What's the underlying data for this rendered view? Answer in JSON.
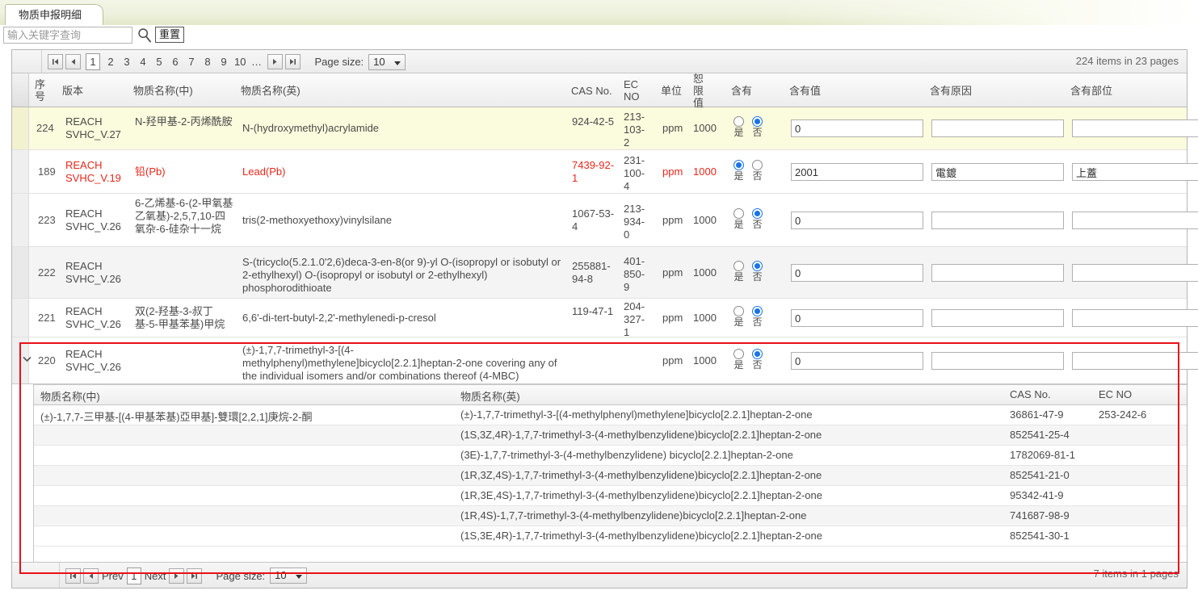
{
  "tab": {
    "label": "物质申报明细"
  },
  "search": {
    "placeholder": "输入关键字查询",
    "value": "",
    "search_icon": "search-icon",
    "reset_label": "重置"
  },
  "top_pager": {
    "first": "|◀",
    "prev": "◀",
    "pages": [
      "1",
      "2",
      "3",
      "4",
      "5",
      "6",
      "7",
      "8",
      "9",
      "10",
      "…"
    ],
    "current": "1",
    "next": "▶",
    "last": "▶|",
    "page_size_label": "Page size:",
    "page_size_value": "10",
    "items_text": "224 items in 23 pages"
  },
  "bottom_pager": {
    "first": "|◀",
    "prev": "◀",
    "prev_label": "Prev",
    "current": "1",
    "next_label": "Next",
    "next": "▶",
    "last": "▶|",
    "page_size_label": "Page size:",
    "page_size_value": "10",
    "items_text": "7 items in 1 pages"
  },
  "columns": [
    {
      "key": "seq",
      "label": "序号"
    },
    {
      "key": "version",
      "label": "版本"
    },
    {
      "key": "name_cn",
      "label": "物质名称(中)"
    },
    {
      "key": "name_en",
      "label": "物质名称(英)"
    },
    {
      "key": "cas",
      "label": "CAS No."
    },
    {
      "key": "ec",
      "label": "EC NO"
    },
    {
      "key": "unit",
      "label": "单位"
    },
    {
      "key": "limit",
      "label": "恕限值"
    },
    {
      "key": "contain",
      "label": "含有"
    },
    {
      "key": "contain_value",
      "label": "含有值"
    },
    {
      "key": "contain_reason",
      "label": "含有原因"
    },
    {
      "key": "contain_part",
      "label": "含有部位"
    }
  ],
  "radio_options": {
    "yes": "是",
    "no": "否"
  },
  "rows": [
    {
      "seq": "224",
      "version": "REACH SVHC_V.27",
      "name_cn": "N-羟甲基-2-丙烯酰胺",
      "name_en": "N-(hydroxymethyl)acrylamide",
      "cas": "924-42-5",
      "ec": "213-103-2",
      "unit": "ppm",
      "limit": "1000",
      "contain": "no",
      "contain_value": "0",
      "contain_reason": "",
      "contain_part": "",
      "style": "selected",
      "expanded": false
    },
    {
      "seq": "189",
      "version": "REACH SVHC_V.19",
      "name_cn": "铅(Pb)",
      "name_en": "Lead(Pb)",
      "cas": "7439-92-1",
      "ec": "231-100-4",
      "unit": "ppm",
      "limit": "1000",
      "contain": "yes",
      "contain_value": "2001",
      "contain_reason": "電鍍",
      "contain_part": "上蓋",
      "style": "alert",
      "expanded": false
    },
    {
      "seq": "223",
      "version": "REACH SVHC_V.26",
      "name_cn": "6-乙烯基-6-(2-甲氧基乙氧基)-2,5,7,10-四氧杂-6-硅杂十一烷",
      "name_en": "tris(2-methoxyethoxy)vinylsilane",
      "cas": "1067-53-4",
      "ec": "213-934-0",
      "unit": "ppm",
      "limit": "1000",
      "contain": "no",
      "contain_value": "0",
      "contain_reason": "",
      "contain_part": "",
      "style": "normal",
      "expanded": false
    },
    {
      "seq": "222",
      "version": "REACH SVHC_V.26",
      "name_cn": "",
      "name_en": "S-(tricyclo(5.2.1.0'2,6)deca-3-en-8(or 9)-yl O-(isopropyl or isobutyl or 2-ethylhexyl) O-(isopropyl or isobutyl or 2-ethylhexyl) phosphorodithioate",
      "cas": "255881-94-8",
      "ec": "401-850-9",
      "unit": "ppm",
      "limit": "1000",
      "contain": "no",
      "contain_value": "0",
      "contain_reason": "",
      "contain_part": "",
      "style": "alt",
      "expanded": false
    },
    {
      "seq": "221",
      "version": "REACH SVHC_V.26",
      "name_cn": "双(2-羟基-3-叔丁基-5-甲基苯基)甲烷",
      "name_en": "6,6'-di-tert-butyl-2,2'-methylenedi-p-cresol",
      "cas": "119-47-1",
      "ec": "204-327-1",
      "unit": "ppm",
      "limit": "1000",
      "contain": "no",
      "contain_value": "0",
      "contain_reason": "",
      "contain_part": "",
      "style": "normal",
      "expanded": false
    },
    {
      "seq": "220",
      "version": "REACH SVHC_V.26",
      "name_cn": "",
      "name_en": "(±)-1,7,7-trimethyl-3-[(4-methylphenyl)methylene]bicyclo[2.2.1]heptan-2-one covering any of the individual isomers and/or combinations thereof (4-MBC)",
      "cas": "",
      "ec": "",
      "unit": "ppm",
      "limit": "1000",
      "contain": "no",
      "contain_value": "0",
      "contain_reason": "",
      "contain_part": "",
      "style": "normal",
      "expanded": true
    }
  ],
  "subgrid": {
    "columns": [
      {
        "key": "name_cn",
        "label": "物质名称(中)"
      },
      {
        "key": "name_en",
        "label": "物质名称(英)"
      },
      {
        "key": "cas",
        "label": "CAS No."
      },
      {
        "key": "ec",
        "label": "EC NO"
      }
    ],
    "rows": [
      {
        "name_cn": "(±)-1,7,7-三甲基-[(4-甲基苯基)亞甲基]-雙環[2,2,1]庚烷-2-酮",
        "name_en": "(±)-1,7,7-trimethyl-3-[(4-methylphenyl)methylene]bicyclo[2.2.1]heptan-2-one",
        "cas": "36861-47-9",
        "ec": "253-242-6"
      },
      {
        "name_cn": "",
        "name_en": "(1S,3Z,4R)-1,7,7-trimethyl-3-(4-methylbenzylidene)bicyclo[2.2.1]heptan-2-one",
        "cas": "852541-25-4",
        "ec": ""
      },
      {
        "name_cn": "",
        "name_en": "(3E)-1,7,7-trimethyl-3-(4-methylbenzylidene) bicyclo[2.2.1]heptan-2-one",
        "cas": "1782069-81-1",
        "ec": ""
      },
      {
        "name_cn": "",
        "name_en": "(1R,3Z,4S)-1,7,7-trimethyl-3-(4-methylbenzylidene)bicyclo[2.2.1]heptan-2-one",
        "cas": "852541-21-0",
        "ec": ""
      },
      {
        "name_cn": "",
        "name_en": "(1R,3E,4S)-1,7,7-trimethyl-3-(4-methylbenzylidene)bicyclo[2.2.1]heptan-2-one",
        "cas": "95342-41-9",
        "ec": ""
      },
      {
        "name_cn": "",
        "name_en": "(1R,4S)-1,7,7-trimethyl-3-(4-methylbenzylidene)bicyclo[2.2.1]heptan-2-one",
        "cas": "741687-98-9",
        "ec": ""
      },
      {
        "name_cn": "",
        "name_en": "(1S,3E,4R)-1,7,7-trimethyl-3-(4-methylbenzylidene)bicyclo[2.2.1]heptan-2-one",
        "cas": "852541-30-1",
        "ec": ""
      }
    ]
  },
  "colors": {
    "alert": "#e8271b",
    "highlight_box": "#e8101a",
    "selected_row": "#fbfbdd",
    "radio_on": "#1a73e8"
  }
}
